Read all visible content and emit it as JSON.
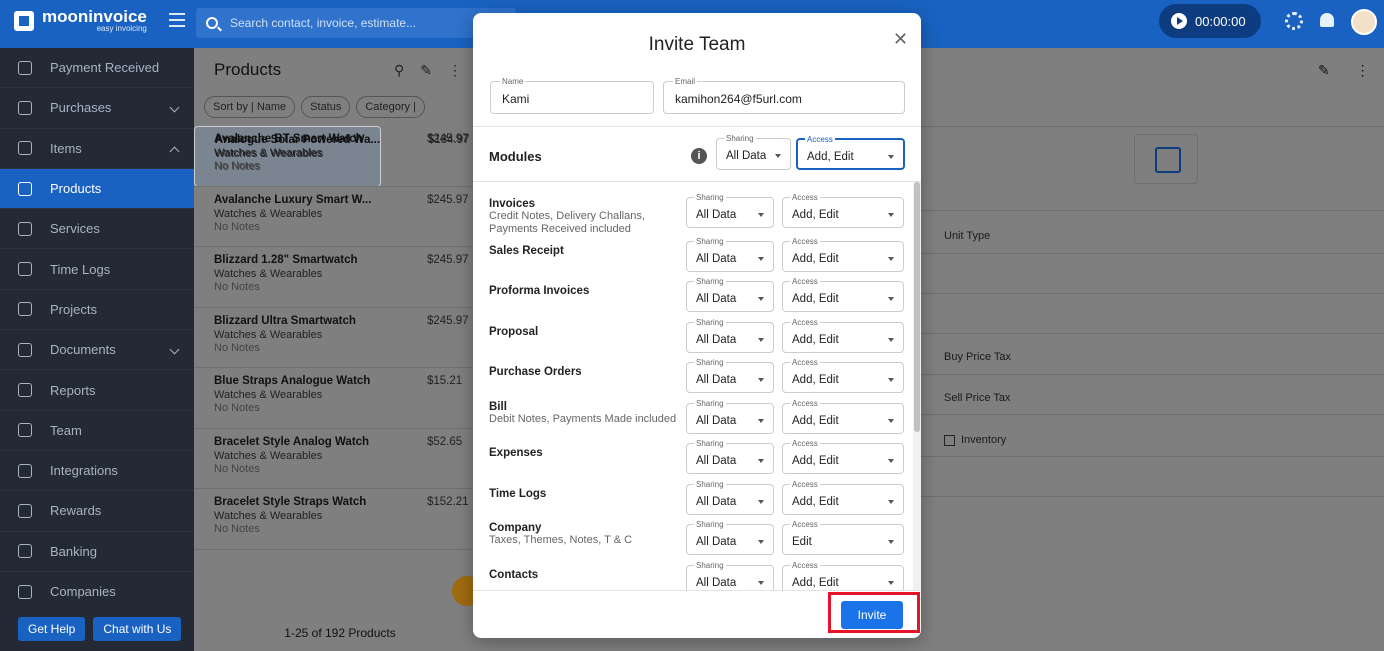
{
  "app": {
    "name": "mooninvoice",
    "tagline": "easy invoicing"
  },
  "search": {
    "placeholder": "Search contact, invoice, estimate..."
  },
  "timer": {
    "value": "00:00:00"
  },
  "sidebar": {
    "items": [
      {
        "label": "Payment Received",
        "icon": "payment-icon"
      },
      {
        "label": "Purchases",
        "icon": "purchases-icon",
        "chevron": "down"
      },
      {
        "label": "Items",
        "icon": "items-icon",
        "chevron": "up"
      },
      {
        "label": "Products",
        "icon": "products-icon",
        "active": true
      },
      {
        "label": "Services",
        "icon": "services-icon"
      },
      {
        "label": "Time Logs",
        "icon": "clock-icon"
      },
      {
        "label": "Projects",
        "icon": "folder-icon"
      },
      {
        "label": "Documents",
        "icon": "document-icon",
        "chevron": "down"
      },
      {
        "label": "Reports",
        "icon": "reports-icon"
      },
      {
        "label": "Team",
        "icon": "team-icon"
      },
      {
        "label": "Integrations",
        "icon": "integrations-icon"
      },
      {
        "label": "Rewards",
        "icon": "gift-icon"
      },
      {
        "label": "Banking",
        "icon": "bank-icon"
      },
      {
        "label": "Companies",
        "icon": "companies-icon"
      }
    ],
    "help_label": "Get Help",
    "chat_label": "Chat with Us"
  },
  "list": {
    "title": "Products",
    "chips": [
      "Sort by | Name",
      "Status",
      "Category |"
    ],
    "products": [
      {
        "name": "Analogue Solar Powered Wa...",
        "category": "Watches & Wearables",
        "notes": "No Notes",
        "price": "$184.97"
      },
      {
        "name": "Avalanche BT Smart Watch",
        "category": "Watches & Wearables",
        "notes": "No Notes",
        "price": "$245.97"
      },
      {
        "name": "Avalanche Luxury Smart W...",
        "category": "Watches & Wearables",
        "notes": "No Notes",
        "price": "$245.97"
      },
      {
        "name": "Blizzard 1.28\" Smartwatch",
        "category": "Watches & Wearables",
        "notes": "No Notes",
        "price": "$245.97"
      },
      {
        "name": "Blizzard Ultra Smartwatch",
        "category": "Watches & Wearables",
        "notes": "No Notes",
        "price": "$245.97"
      },
      {
        "name": "Blue Straps Analogue Watch",
        "category": "Watches & Wearables",
        "notes": "No Notes",
        "price": "$15.21"
      },
      {
        "name": "Bracelet Style Analog Watch",
        "category": "Watches & Wearables",
        "notes": "No Notes",
        "price": "$52.65"
      },
      {
        "name": "Bracelet Style Straps Watch",
        "category": "Watches & Wearables",
        "notes": "No Notes",
        "price": "$152.21"
      }
    ],
    "pager": "1-25 of 192 Products"
  },
  "detail": {
    "unit_type": "Unit Type",
    "buy_tax": "Buy Price Tax",
    "sell_tax": "Sell Price Tax",
    "inventory": "Inventory"
  },
  "modal": {
    "title": "Invite Team",
    "name_label": "Name",
    "name_value": "Kami",
    "email_label": "Email",
    "email_value": "kamihon264@f5url.com",
    "modules_title": "Modules",
    "sharing_label": "Sharing",
    "access_label": "Access",
    "header_sharing": "All Data",
    "header_access": "Add, Edit",
    "modules": [
      {
        "name": "Invoices",
        "sub": "Credit Notes, Delivery Challans, Payments Received included",
        "sharing": "All Data",
        "access": "Add, Edit"
      },
      {
        "name": "Sales Receipt",
        "sub": "",
        "sharing": "All Data",
        "access": "Add, Edit"
      },
      {
        "name": "Proforma Invoices",
        "sub": "",
        "sharing": "All Data",
        "access": "Add, Edit"
      },
      {
        "name": "Proposal",
        "sub": "",
        "sharing": "All Data",
        "access": "Add, Edit"
      },
      {
        "name": "Purchase Orders",
        "sub": "",
        "sharing": "All Data",
        "access": "Add, Edit"
      },
      {
        "name": "Bill",
        "sub": "Debit Notes, Payments Made included",
        "sharing": "All Data",
        "access": "Add, Edit"
      },
      {
        "name": "Expenses",
        "sub": "",
        "sharing": "All Data",
        "access": "Add, Edit"
      },
      {
        "name": "Time Logs",
        "sub": "",
        "sharing": "All Data",
        "access": "Add, Edit"
      },
      {
        "name": "Company",
        "sub": "Taxes, Themes, Notes, T & C",
        "sharing": "All Data",
        "access": "Edit"
      },
      {
        "name": "Contacts",
        "sub": "",
        "sharing": "All Data",
        "access": "Add, Edit"
      }
    ],
    "invite_label": "Invite"
  },
  "colors": {
    "brand": "#1a62c1",
    "highlight": "#e5142a",
    "sidebar": "#232a36"
  }
}
